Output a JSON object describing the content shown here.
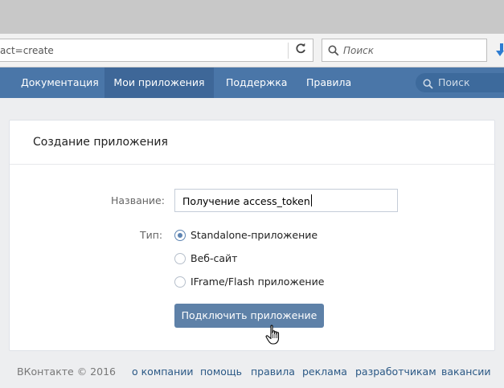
{
  "browser": {
    "url": "act=create",
    "search_placeholder": "Поиск"
  },
  "vk_nav": {
    "items": [
      {
        "label": "Документация"
      },
      {
        "label": "Мои приложения"
      },
      {
        "label": "Поддержка"
      },
      {
        "label": "Правила"
      }
    ],
    "search_placeholder": "Поиск"
  },
  "form": {
    "title": "Создание приложения",
    "name_label": "Название:",
    "name_value": "Получение access_token",
    "type_label": "Тип:",
    "type_options": [
      {
        "label": "Standalone-приложение",
        "checked": true
      },
      {
        "label": "Веб-сайт",
        "checked": false
      },
      {
        "label": "IFrame/Flash приложение",
        "checked": false
      }
    ],
    "submit_label": "Подключить приложение"
  },
  "footer": {
    "copyright": "ВКонтакте © 2016",
    "links": [
      "о компании",
      "помощь",
      "правила",
      "реклама",
      "разработчикам",
      "вакансии"
    ]
  },
  "colors": {
    "header": "#4a76a8",
    "button": "#5e81a8",
    "link": "#2a5885"
  }
}
